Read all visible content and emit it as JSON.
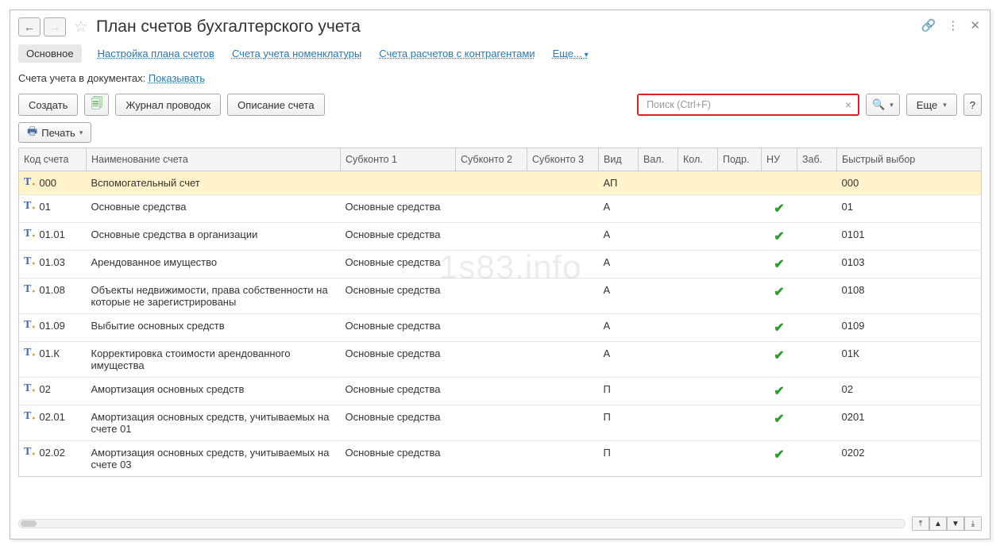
{
  "header": {
    "title": "План счетов бухгалтерского учета"
  },
  "tabs": {
    "main": "Основное",
    "settings": "Настройка плана счетов",
    "nomenclature": "Счета учета номенклатуры",
    "contractors": "Счета расчетов с контрагентами",
    "more": "Еще..."
  },
  "doc_line": {
    "label": "Счета учета в документах:",
    "link": "Показывать"
  },
  "toolbar": {
    "create": "Создать",
    "journal": "Журнал проводок",
    "desc": "Описание счета",
    "more_btn": "Еще",
    "help": "?",
    "search_placeholder": "Поиск (Ctrl+F)"
  },
  "print": {
    "label": "Печать"
  },
  "columns": {
    "code": "Код счета",
    "name": "Наименование счета",
    "sub1": "Субконто 1",
    "sub2": "Субконто 2",
    "sub3": "Субконто 3",
    "type": "Вид",
    "val": "Вал.",
    "qty": "Кол.",
    "dept": "Подр.",
    "nu": "НУ",
    "zab": "Заб.",
    "quick": "Быстрый выбор"
  },
  "rows": [
    {
      "code": "000",
      "name": "Вспомогательный счет",
      "sub1": "",
      "type": "АП",
      "nu": false,
      "quick": "000",
      "sel": true
    },
    {
      "code": "01",
      "name": "Основные средства",
      "sub1": "Основные средства",
      "type": "А",
      "nu": true,
      "quick": "01"
    },
    {
      "code": "01.01",
      "name": "Основные средства в организации",
      "sub1": "Основные средства",
      "type": "А",
      "nu": true,
      "quick": "0101"
    },
    {
      "code": "01.03",
      "name": "Арендованное имущество",
      "sub1": "Основные средства",
      "type": "А",
      "nu": true,
      "quick": "0103"
    },
    {
      "code": "01.08",
      "name": "Объекты недвижимости, права собственности на которые не зарегистрированы",
      "sub1": "Основные средства",
      "type": "А",
      "nu": true,
      "quick": "0108"
    },
    {
      "code": "01.09",
      "name": "Выбытие основных средств",
      "sub1": "Основные средства",
      "type": "А",
      "nu": true,
      "quick": "0109"
    },
    {
      "code": "01.К",
      "name": "Корректировка стоимости арендованного имущества",
      "sub1": "Основные средства",
      "type": "А",
      "nu": true,
      "quick": "01К"
    },
    {
      "code": "02",
      "name": "Амортизация основных средств",
      "sub1": "Основные средства",
      "type": "П",
      "nu": true,
      "quick": "02"
    },
    {
      "code": "02.01",
      "name": "Амортизация основных средств, учитываемых на счете 01",
      "sub1": "Основные средства",
      "type": "П",
      "nu": true,
      "quick": "0201"
    },
    {
      "code": "02.02",
      "name": "Амортизация основных средств, учитываемых на счете 03",
      "sub1": "Основные средства",
      "type": "П",
      "nu": true,
      "quick": "0202"
    }
  ],
  "watermark": "1s83.info"
}
